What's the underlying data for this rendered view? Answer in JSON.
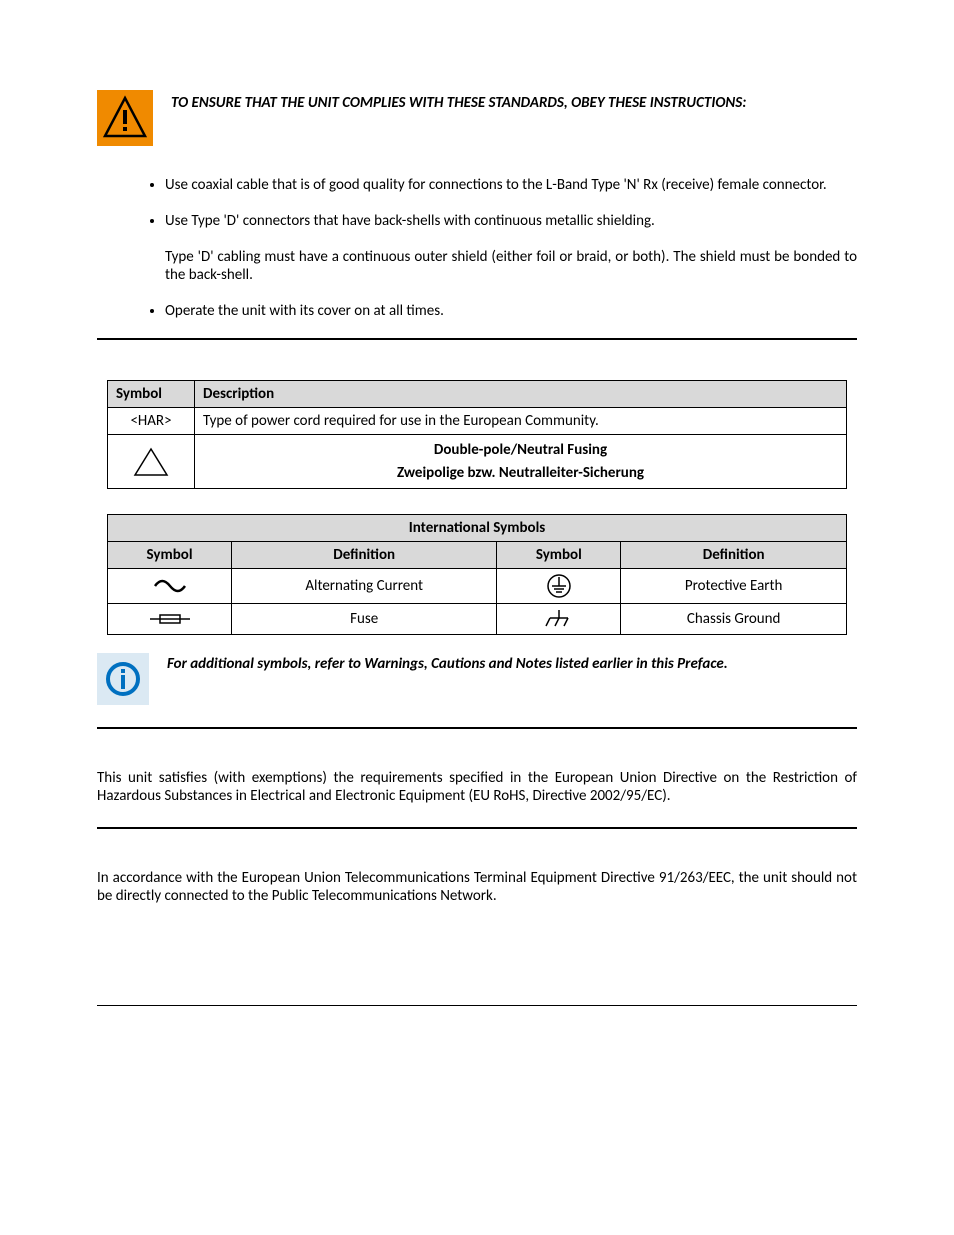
{
  "warning": {
    "text": "TO ENSURE THAT THE UNIT COMPLIES WITH THESE STANDARDS, OBEY THESE INSTRUCTIONS:"
  },
  "bullets": {
    "b1": "Use coaxial cable that is of good quality for connections to the L-Band Type 'N' Rx (receive) female connector.",
    "b2": "Use Type 'D' connectors that have back-shells with continuous metallic shielding.",
    "b2_sub": "Type 'D' cabling must have a continuous outer shield (either foil or braid, or both). The shield must be bonded to the back-shell.",
    "b3": "Operate the unit with its cover on at all times."
  },
  "table1": {
    "h1": "Symbol",
    "h2": "Description",
    "r1c1": "<HAR>",
    "r1c2": "Type of power cord required for use in the European Community.",
    "r2_line1": "Double-pole/Neutral Fusing",
    "r2_line2": "Zweipolige bzw. Neutralleiter-Sicherung"
  },
  "table2": {
    "title": "International Symbols",
    "h_sym": "Symbol",
    "h_def": "Definition",
    "ac": "Alternating Current",
    "pe": "Protective Earth",
    "fuse": "Fuse",
    "cg": "Chassis Ground"
  },
  "info": {
    "text": "For additional symbols, refer to Warnings, Cautions and Notes listed earlier in this Preface."
  },
  "para1": "This unit satisfies (with exemptions) the requirements specified in the European Union Directive on the Restriction of Hazardous Substances in Electrical and Electronic Equipment (EU RoHS, Directive 2002/95/EC).",
  "para2": "In accordance with the European Union Telecommunications Terminal Equipment Directive 91/263/EEC, the unit should not be directly connected to the Public Telecommunications Network."
}
